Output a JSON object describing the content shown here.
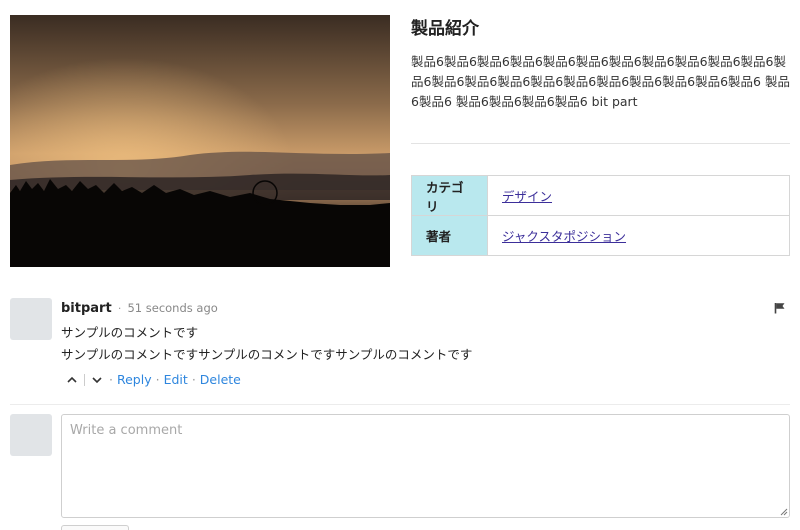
{
  "product": {
    "image_alt": "sunset-rain-landscape",
    "title": "製品紹介",
    "description": "製品6製品6製品6製品6製品6製品6製品6製品6製品6製品6製品6製品6製品6製品6製品6製品6製品6製品6製品6製品6製品6製品6 製品6製品6 製品6製品6製品6製品6 bit part",
    "specs": [
      {
        "label": "カテゴリ",
        "value": "デザイン"
      },
      {
        "label": "著者",
        "value": "ジャクスタポジション"
      }
    ]
  },
  "comment": {
    "author": "bitpart",
    "separator": "·",
    "time": "51 seconds ago",
    "lines": [
      "サンプルのコメントです",
      "サンプルのコメントですサンプルのコメントですサンプルのコメントです"
    ],
    "actions": {
      "reply": "Reply",
      "edit": "Edit",
      "delete": "Delete"
    }
  },
  "new_comment": {
    "placeholder": "Write a comment"
  },
  "colors": {
    "table_header_bg": "#b9e8ee",
    "link": "#3c2f9a",
    "action_link": "#2e86de",
    "avatar": "#e1e4e7"
  },
  "icons": [
    "flag-icon",
    "upvote-chevron-icon",
    "downvote-chevron-icon",
    "resize-grip-icon"
  ]
}
